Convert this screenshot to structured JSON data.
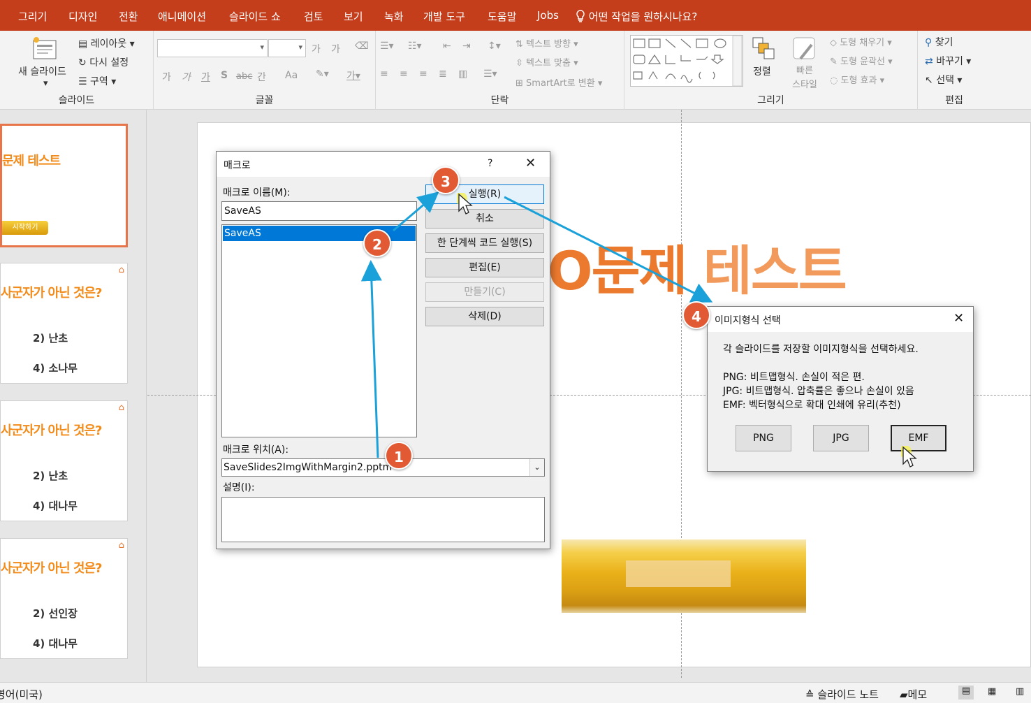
{
  "menu": [
    "그리기",
    "디자인",
    "전환",
    "애니메이션",
    "슬라이드 쇼",
    "검토",
    "보기",
    "녹화",
    "개발 도구",
    "도움말",
    "Jobs"
  ],
  "tellme": "어떤 작업을 원하시나요?",
  "ribbon": {
    "slides": {
      "new_slide": "새 슬라이드",
      "layout": "레이아웃",
      "reset": "다시 설정",
      "section": "구역",
      "label": "슬라이드"
    },
    "font": {
      "label": "글꼴",
      "row2": [
        "가",
        "가",
        "가",
        "S",
        "abc",
        "간",
        "Aa"
      ],
      "grow": "가",
      "shrink": "가"
    },
    "paragraph": {
      "text_direction": "텍스트 방향",
      "align_text": "텍스트 맞춤",
      "smartart": "SmartArt로 변환",
      "label": "단락"
    },
    "drawing": {
      "arrange": "정렬",
      "quick_styles": "빠른\n스타일",
      "fill": "도형 채우기",
      "outline": "도형 윤곽선",
      "effects": "도형 효과",
      "label": "그리기"
    },
    "editing": {
      "find": "찾기",
      "replace": "바꾸기",
      "select": "선택",
      "label": "편집"
    }
  },
  "thumbs": [
    {
      "title": "문제 테스트",
      "start": "시작하기"
    },
    {
      "q": "사군자가 아닌 것은?",
      "a1": "2) 난초",
      "a2": "4) 소나무"
    },
    {
      "q": "사군자가 아닌 것은?",
      "a1": "2) 난초",
      "a2": "4) 대나무"
    },
    {
      "q": "사군자가 아닌 것은?",
      "a1": "2) 선인장",
      "a2": "4) 대나무"
    }
  ],
  "slide": {
    "title_part1": "O문제 ",
    "title_part2": "테스트"
  },
  "macro": {
    "title": "매크로",
    "help": "?",
    "name_label": "매크로 이름(M):",
    "name_value": "SaveAS",
    "list": [
      "SaveAS"
    ],
    "location_label": "매크로 위치(A):",
    "location_value": "SaveSlides2ImgWithMargin2.pptm",
    "desc_label": "설명(I):",
    "buttons": {
      "run": "실행(R)",
      "cancel": "취소",
      "step": "한 단계씩 코드 실행(S)",
      "edit": "편집(E)",
      "create": "만들기(C)",
      "delete": "삭제(D)"
    }
  },
  "imgdialog": {
    "title": "이미지형식 선택",
    "prompt": "각 슬라이드를 저장할 이미지형식을 선택하세요.",
    "png_desc": "PNG: 비트맵형식. 손실이 적은 편.",
    "jpg_desc": "JPG: 비트맵형식. 압축률은 좋으나 손실이 있음",
    "emf_desc": "EMF: 벡터형식으로 확대 인쇄에 유리(추천)",
    "buttons": {
      "png": "PNG",
      "jpg": "JPG",
      "emf": "EMF"
    }
  },
  "badges": [
    "1",
    "2",
    "3",
    "4"
  ],
  "status": {
    "lang": "영어(미국)",
    "notes": "슬라이드 노트",
    "comments": "메모"
  },
  "colors": {
    "accent": "#c43e1c",
    "badge": "#e15a33",
    "arrow": "#1aa1d9",
    "selection": "#0078d7"
  }
}
